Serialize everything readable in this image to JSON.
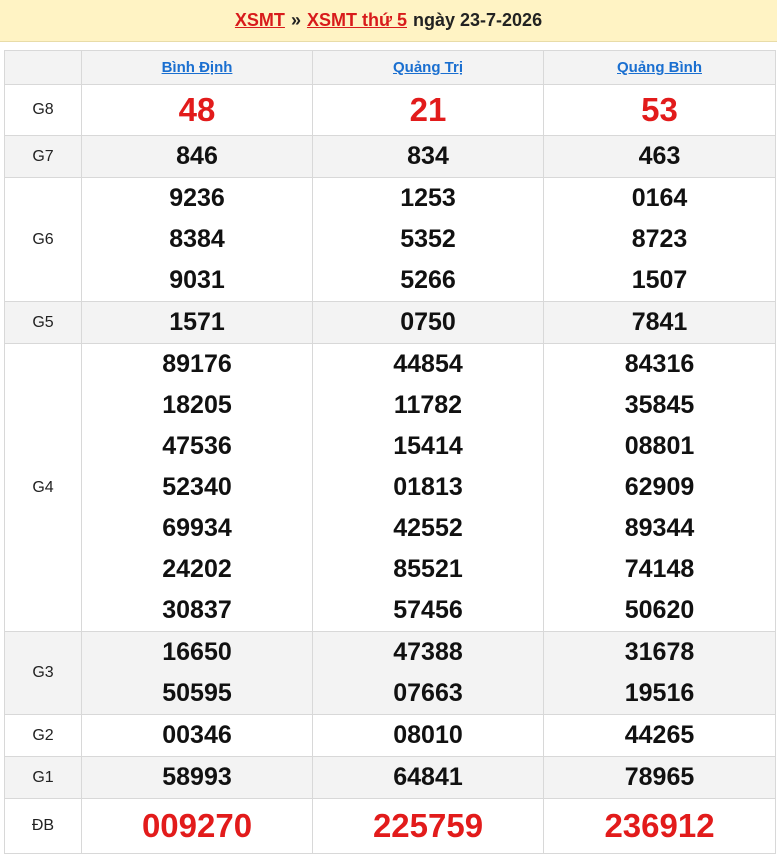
{
  "header": {
    "link1": "XSMT",
    "separator": "»",
    "link2": "XSMT thứ 5",
    "date_text": "ngày 23-7-2026"
  },
  "columns": [
    "Bình Định",
    "Quảng Trị",
    "Quảng Bình"
  ],
  "rows": [
    {
      "label": "G8",
      "values": [
        [
          "48"
        ],
        [
          "21"
        ],
        [
          "53"
        ]
      ]
    },
    {
      "label": "G7",
      "values": [
        [
          "846"
        ],
        [
          "834"
        ],
        [
          "463"
        ]
      ]
    },
    {
      "label": "G6",
      "values": [
        [
          "9236",
          "8384",
          "9031"
        ],
        [
          "1253",
          "5352",
          "5266"
        ],
        [
          "0164",
          "8723",
          "1507"
        ]
      ]
    },
    {
      "label": "G5",
      "values": [
        [
          "1571"
        ],
        [
          "0750"
        ],
        [
          "7841"
        ]
      ]
    },
    {
      "label": "G4",
      "values": [
        [
          "89176",
          "18205",
          "47536",
          "52340",
          "69934",
          "24202",
          "30837"
        ],
        [
          "44854",
          "11782",
          "15414",
          "01813",
          "42552",
          "85521",
          "57456"
        ],
        [
          "84316",
          "35845",
          "08801",
          "62909",
          "89344",
          "74148",
          "50620"
        ]
      ]
    },
    {
      "label": "G3",
      "values": [
        [
          "16650",
          "50595"
        ],
        [
          "47388",
          "07663"
        ],
        [
          "31678",
          "19516"
        ]
      ]
    },
    {
      "label": "G2",
      "values": [
        [
          "00346"
        ],
        [
          "08010"
        ],
        [
          "44265"
        ]
      ]
    },
    {
      "label": "G1",
      "values": [
        [
          "58993"
        ],
        [
          "64841"
        ],
        [
          "78965"
        ]
      ]
    },
    {
      "label": "ĐB",
      "values": [
        [
          "009270"
        ],
        [
          "225759"
        ],
        [
          "236912"
        ]
      ]
    }
  ],
  "colors": {
    "accent_red": "#e21b1b",
    "link_blue": "#1a6fd0",
    "header_bg": "#fff3c4"
  }
}
